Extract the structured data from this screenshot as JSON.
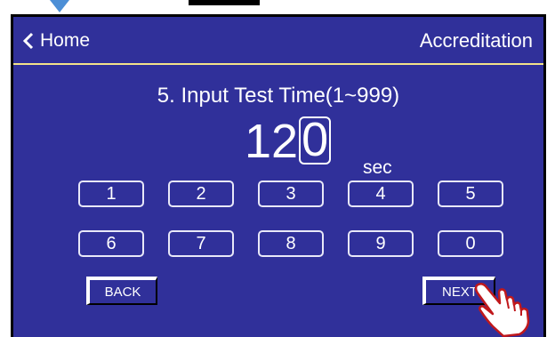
{
  "header": {
    "home_label": "Home",
    "title": "Accreditation"
  },
  "prompt": "5. Input Test Time(1~999)",
  "entry": {
    "digits": "12",
    "cursor_digit": "0",
    "unit": "sec"
  },
  "keypad": {
    "keys": [
      "1",
      "2",
      "3",
      "4",
      "5",
      "6",
      "7",
      "8",
      "9",
      "0"
    ]
  },
  "nav": {
    "back_label": "BACK",
    "next_label": "NEXT"
  },
  "icons": {
    "home_chevron": "chevron-left-icon",
    "pointer": "hand-pointer-icon"
  },
  "colors": {
    "screen_bg": "#30309a",
    "header_rule": "#f4e28a",
    "text": "#ffffff"
  }
}
